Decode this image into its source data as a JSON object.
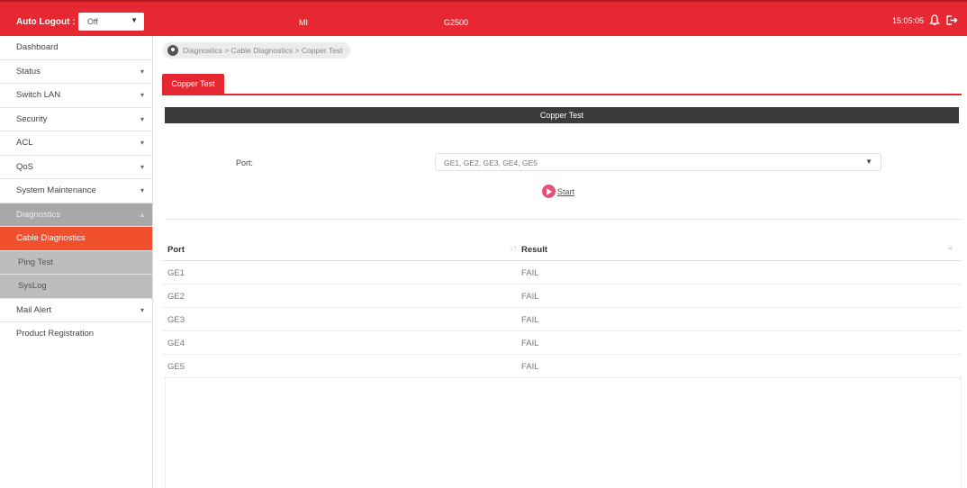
{
  "topbar": {
    "auto_logout_label": "Auto Logout :",
    "auto_logout_value": "Off",
    "mid_text_1": "MI",
    "mid_text_2": "G2500",
    "time": "15:05:05",
    "accent_color": "#e52831"
  },
  "sidebar": {
    "items": [
      {
        "label": "Dashboard"
      },
      {
        "label": "Status"
      },
      {
        "label": "Switch LAN"
      },
      {
        "label": "Security"
      },
      {
        "label": "ACL"
      },
      {
        "label": "QoS"
      },
      {
        "label": "System Maintenance"
      },
      {
        "label": "Diagnostics"
      },
      {
        "label": "Cable Diagnostics"
      },
      {
        "label": "Ping Test"
      },
      {
        "label": "SysLog"
      },
      {
        "label": "Mail Alert"
      },
      {
        "label": "Product Registration"
      }
    ]
  },
  "breadcrumb": "Diagnostics > Cable Diagnostics > Copper Test",
  "tabs": [
    {
      "label": "Copper Test"
    }
  ],
  "section_title": "Copper Test",
  "form": {
    "port_label": "Port:",
    "port_value": "GE1, GE2, GE3, GE4, GE5",
    "start_label": "Start"
  },
  "table": {
    "headers": [
      "Port",
      "Result"
    ],
    "rows": [
      [
        "GE1",
        "FAIL"
      ],
      [
        "GE2",
        "FAIL"
      ],
      [
        "GE3",
        "FAIL"
      ],
      [
        "GE4",
        "FAIL"
      ],
      [
        "GE5",
        "FAIL"
      ]
    ]
  }
}
